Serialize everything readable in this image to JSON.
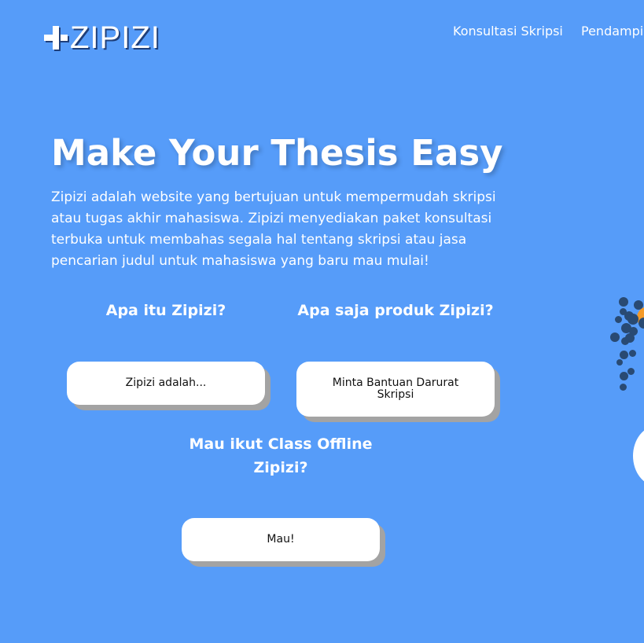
{
  "header": {
    "logo_text": "ZIPIZI",
    "nav": [
      "Konsultasi Skripsi",
      "Pendampi"
    ]
  },
  "hero": {
    "title": "Make Your Thesis Easy",
    "description": "Zipizi adalah website yang bertujuan untuk mempermudah skripsi atau tugas akhir mahasiswa. Zipizi menyediakan paket konsultasi terbuka untuk membahas segala hal tentang skripsi atau jasa pencarian judul untuk mahasiswa yang baru mau mulai!"
  },
  "sections": [
    {
      "question": "Apa itu Zipizi?",
      "button": "Zipizi adalah..."
    },
    {
      "question": "Apa saja produk Zipizi?",
      "button": "Minta Bantuan Darurat Skripsi"
    },
    {
      "question": "Mau ikut Class Offline Zipizi?",
      "button": "Mau!"
    }
  ],
  "colors": {
    "background": "#569cf9",
    "text": "#ffffff",
    "button_bg": "#ffffff",
    "button_shadow": "#a3a3a3",
    "dots": "#294a73",
    "accent_orange": "#f59a27"
  },
  "icons": {
    "logo_mark": "plus-icon"
  }
}
